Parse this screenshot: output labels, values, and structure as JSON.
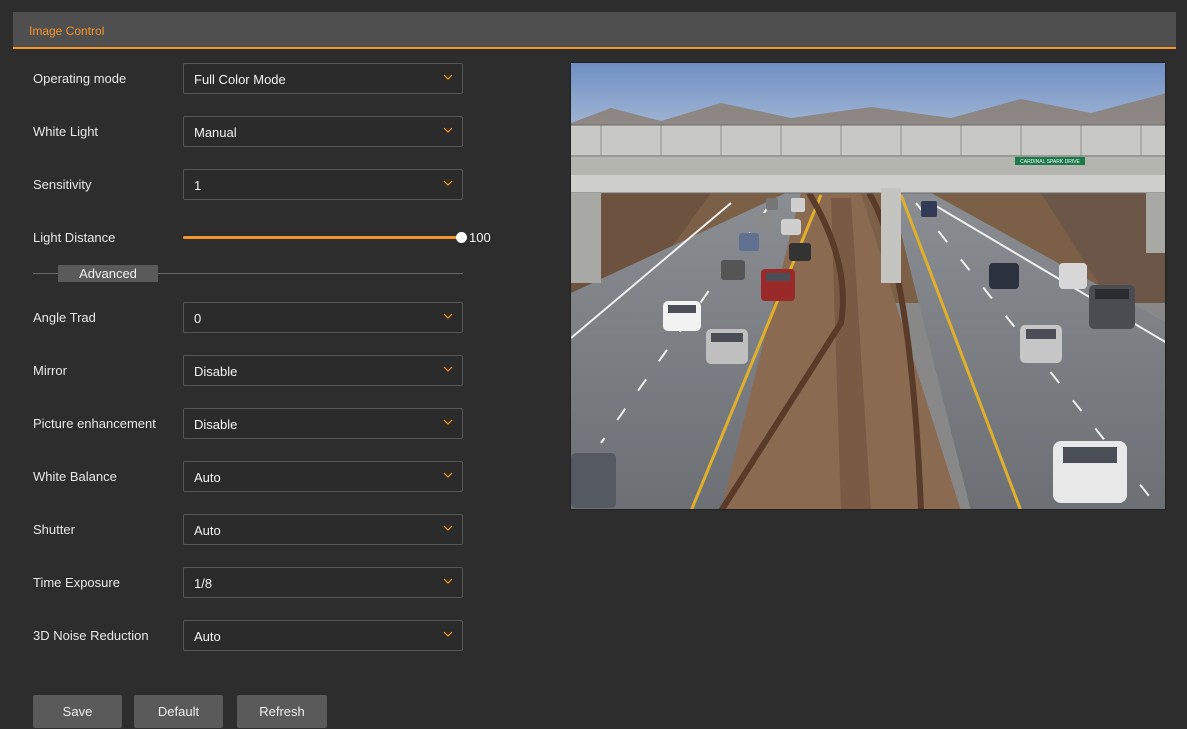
{
  "header": {
    "tab_label": "Image Control"
  },
  "settings": {
    "operating_mode": {
      "label": "Operating mode",
      "value": "Full Color Mode"
    },
    "white_light": {
      "label": "White Light",
      "value": "Manual"
    },
    "sensitivity": {
      "label": "Sensitivity",
      "value": "1"
    },
    "light_distance": {
      "label": "Light Distance",
      "value": "100",
      "level": 100
    },
    "advanced_label": "Advanced",
    "angle_trad": {
      "label": "Angle Trad",
      "value": "0"
    },
    "mirror": {
      "label": "Mirror",
      "value": "Disable"
    },
    "picture_enhancement": {
      "label": "Picture enhancement",
      "value": "Disable"
    },
    "white_balance": {
      "label": "White Balance",
      "value": "Auto"
    },
    "shutter": {
      "label": "Shutter",
      "value": "Auto"
    },
    "time_exposure": {
      "label": "Time Exposure",
      "value": "1/8"
    },
    "noise_reduction": {
      "label": "3D Noise Reduction",
      "value": "Auto"
    }
  },
  "buttons": {
    "save": "Save",
    "default": "Default",
    "refresh": "Refresh"
  },
  "video": {
    "sign_text": "CARDINAL SPARK DRIVE"
  },
  "colors": {
    "accent": "#f3952a",
    "background": "#2d2d2d",
    "header": "#4f4f4f",
    "button": "#5a5a5a"
  },
  "icons": {
    "dropdown": "chevron-down-icon",
    "slider": "slider-thumb"
  }
}
